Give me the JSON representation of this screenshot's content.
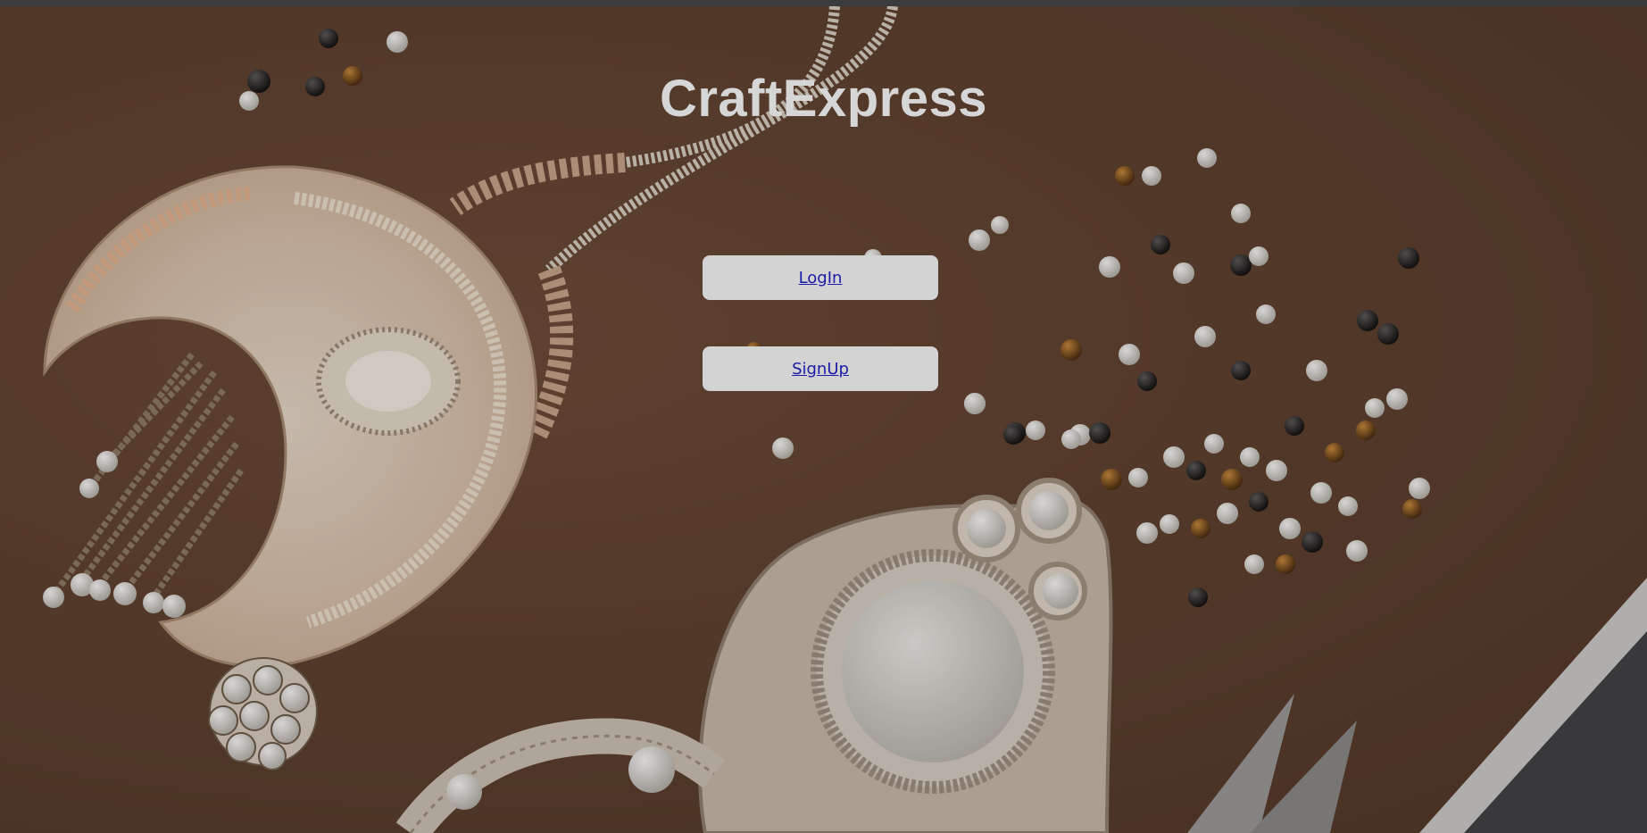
{
  "app": {
    "title": "CraftExpress"
  },
  "actions": {
    "login_label": "LogIn",
    "signup_label": "SignUp"
  },
  "background": {
    "description_icon": "beaded-jewelry-background",
    "base_color": "#5c3f2e",
    "button_color": "#d3d3d3",
    "link_color": "#1a1aa6",
    "title_color": "#d6d6d6"
  }
}
